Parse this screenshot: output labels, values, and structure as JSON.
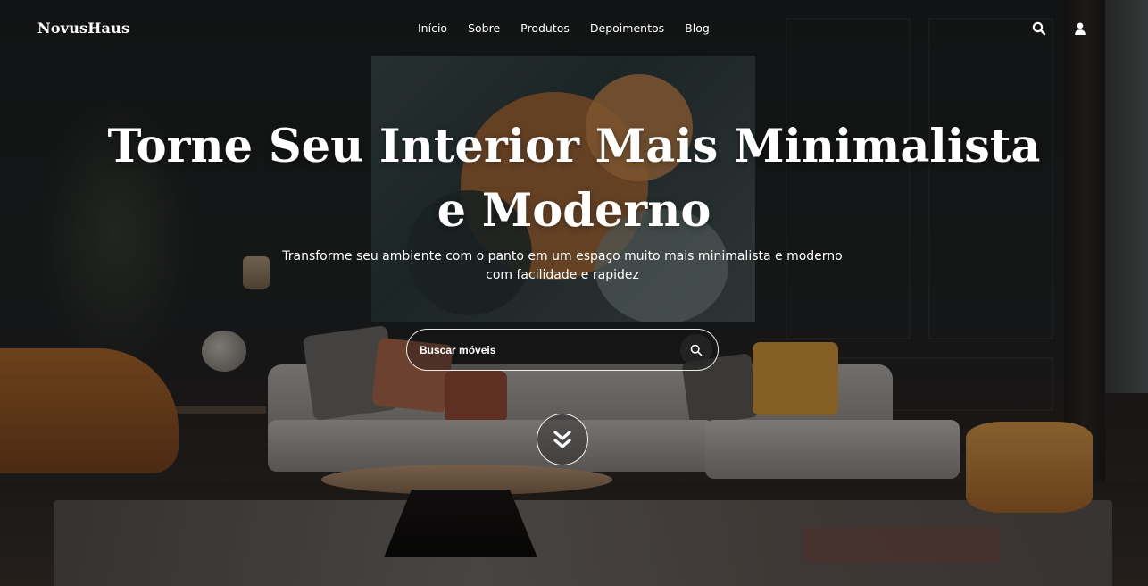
{
  "brand": {
    "name": "NovusHaus"
  },
  "nav": {
    "items": [
      {
        "label": "Início"
      },
      {
        "label": "Sobre"
      },
      {
        "label": "Produtos"
      },
      {
        "label": "Depoimentos"
      },
      {
        "label": "Blog"
      }
    ],
    "icons": [
      "search-icon",
      "user-icon"
    ]
  },
  "hero": {
    "title": "Torne Seu Interior Mais Minimalista e Moderno",
    "subtitle": "Transforme seu ambiente com o panto em um espaço muito mais minimalista e moderno com facilidade e rapidez"
  },
  "search": {
    "placeholder": "Buscar móveis",
    "icon": "search-icon"
  },
  "scroll": {
    "icon": "double-chevron-down-icon"
  },
  "colors": {
    "text": "#ffffff",
    "background": "#1e2021",
    "accent_orange": "#d99a4c",
    "sofa": "#b7b3af"
  }
}
